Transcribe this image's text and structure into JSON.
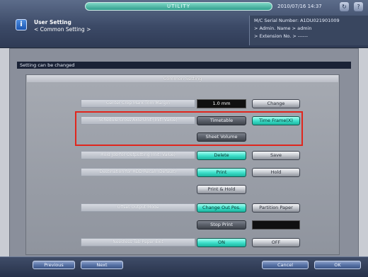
{
  "header": {
    "utility_label": "UTILITY",
    "datetime": "2010/07/16 14:37",
    "title_main": "User Setting",
    "title_sub": "< Common Setting >",
    "info_lines": [
      "M/C Serial Number: A1DU021901009",
      "> Admin. Name > admin",
      "> Extension No. > ------"
    ],
    "icons": [
      "refresh-icon",
      "help-icon"
    ]
  },
  "status": {
    "text": "Setting can be changed"
  },
  "panel": {
    "title": "Common Setting",
    "rows": {
      "center_crop": {
        "label": "Center Crop Mark Trim Margin",
        "value": "1.0 mm",
        "button": "Change"
      },
      "schedule": {
        "label": "Schedule Cross Axle Unit (Init. Value)",
        "options": [
          "Timetable",
          "Time Frame(X)",
          "Sheet Volume"
        ],
        "selected": "Time Frame(X)"
      },
      "hold_job": {
        "label": "Hold Job for Outputting (Init. Value)",
        "options": [
          "Delete",
          "Save"
        ],
        "selected": "Delete"
      },
      "hdd_recall": {
        "label": "Destination for HDD Recall (Default)",
        "options": [
          "Print",
          "Hold",
          "Print & Hold"
        ],
        "selected": "Print"
      },
      "offset": {
        "label": "Offset Output Mode",
        "options": [
          "Change Out Pos.",
          "Partition Paper",
          "Stop Print"
        ],
        "selected": "Change Out Pos."
      },
      "needless": {
        "label": "Needless Tab Paper Exit",
        "options": [
          "ON",
          "OFF"
        ],
        "selected": "ON"
      }
    }
  },
  "footer": {
    "previous": "Previous",
    "next": "Next",
    "cancel": "Cancel",
    "ok": "OK"
  },
  "colors": {
    "selected": "#40e0cb",
    "highlight": "#e0261d",
    "header": "#3c4a67"
  }
}
